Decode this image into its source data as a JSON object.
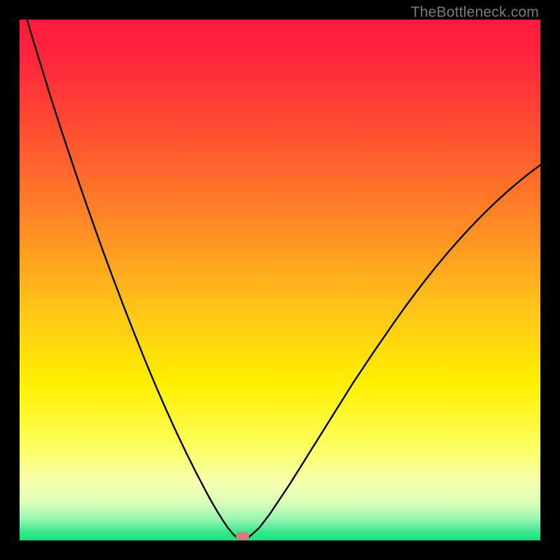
{
  "watermark": "TheBottleneck.com",
  "colors": {
    "frame": "#000000",
    "marker": "#cc7f7f",
    "curve": "#000000",
    "gradient_stops": [
      {
        "offset": 0.0,
        "color": "#ff183f"
      },
      {
        "offset": 0.1,
        "color": "#ff2c3a"
      },
      {
        "offset": 0.25,
        "color": "#ff5a2f"
      },
      {
        "offset": 0.4,
        "color": "#ff8c24"
      },
      {
        "offset": 0.55,
        "color": "#ffc21a"
      },
      {
        "offset": 0.7,
        "color": "#fff000"
      },
      {
        "offset": 0.82,
        "color": "#fcff60"
      },
      {
        "offset": 0.89,
        "color": "#f6ffb0"
      },
      {
        "offset": 0.93,
        "color": "#d6ffb8"
      },
      {
        "offset": 0.96,
        "color": "#95f5b0"
      },
      {
        "offset": 0.985,
        "color": "#34e78a"
      },
      {
        "offset": 1.0,
        "color": "#17e37e"
      }
    ]
  },
  "chart_data": {
    "type": "line",
    "title": "",
    "xlabel": "",
    "ylabel": "",
    "xlim": [
      0,
      100
    ],
    "ylim": [
      0,
      100
    ],
    "grid": false,
    "x": [
      0,
      2,
      4,
      6,
      8,
      10,
      12,
      14,
      16,
      18,
      20,
      22,
      24,
      26,
      28,
      30,
      32,
      34,
      36,
      37,
      38,
      39,
      40,
      41,
      42,
      43,
      44,
      46,
      48,
      50,
      52,
      54,
      56,
      58,
      60,
      62,
      64,
      66,
      68,
      70,
      72,
      74,
      76,
      78,
      80,
      82,
      84,
      86,
      88,
      90,
      92,
      94,
      96,
      98,
      100
    ],
    "values": [
      105,
      98,
      91.5,
      85,
      78.8,
      72.8,
      66.9,
      61.2,
      55.6,
      50.2,
      44.9,
      39.8,
      34.8,
      30.0,
      25.4,
      21.0,
      16.8,
      12.8,
      9.0,
      7.2,
      5.5,
      3.9,
      2.4,
      1.2,
      0.3,
      0.0,
      0.6,
      2.4,
      5.0,
      8.0,
      11.0,
      14.2,
      17.4,
      20.6,
      23.8,
      27.0,
      30.2,
      33.2,
      36.2,
      39.1,
      42.0,
      44.8,
      47.5,
      50.1,
      52.6,
      55.0,
      57.3,
      59.5,
      61.6,
      63.6,
      65.5,
      67.3,
      69.0,
      70.6,
      72.1
    ],
    "min_point": {
      "x": 43,
      "y": 0
    },
    "marker": {
      "x_center": 42.8,
      "width": 2.6,
      "height": 1.6
    }
  }
}
